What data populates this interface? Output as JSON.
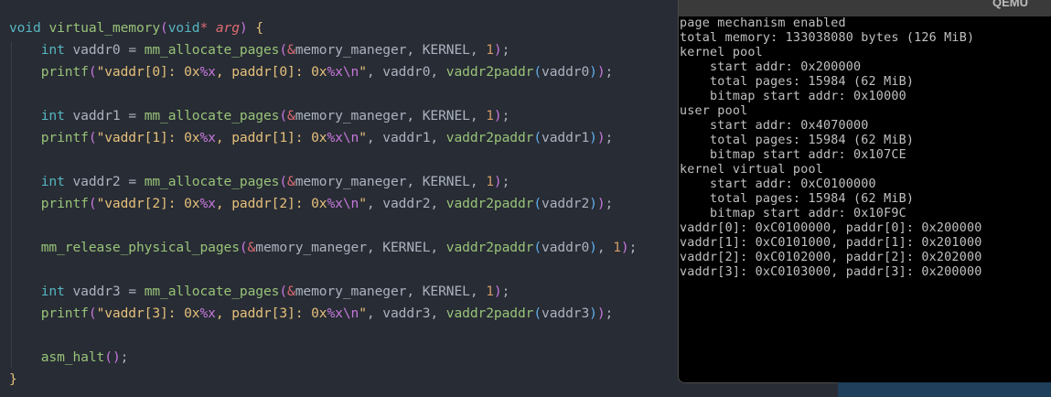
{
  "editor": {
    "lines": [
      "void virtual_memory(void* arg) {",
      "    int vaddr0 = mm_allocate_pages(&memory_maneger, KERNEL, 1);",
      "    printf(\"vaddr[0]: 0x%x, paddr[0]: 0x%x\\n\", vaddr0, vaddr2paddr(vaddr0));",
      "",
      "    int vaddr1 = mm_allocate_pages(&memory_maneger, KERNEL, 1);",
      "    printf(\"vaddr[1]: 0x%x, paddr[1]: 0x%x\\n\", vaddr1, vaddr2paddr(vaddr1));",
      "",
      "    int vaddr2 = mm_allocate_pages(&memory_maneger, KERNEL, 1);",
      "    printf(\"vaddr[2]: 0x%x, paddr[2]: 0x%x\\n\", vaddr2, vaddr2paddr(vaddr2));",
      "",
      "    mm_release_physical_pages(&memory_maneger, KERNEL, vaddr2paddr(vaddr0), 1);",
      "",
      "    int vaddr3 = mm_allocate_pages(&memory_maneger, KERNEL, 1);",
      "    printf(\"vaddr[3]: 0x%x, paddr[3]: 0x%x\\n\", vaddr3, vaddr2paddr(vaddr3));",
      "",
      "    asm_halt();",
      "}"
    ]
  },
  "qemu": {
    "title": "QEMU",
    "output": [
      "page mechanism enabled",
      "total memory: 133038080 bytes (126 MiB)",
      "kernel pool",
      "    start addr: 0x200000",
      "    total pages: 15984 (62 MiB)",
      "    bitmap start addr: 0x10000",
      "user pool",
      "    start addr: 0x4070000",
      "    total pages: 15984 (62 MiB)",
      "    bitmap start addr: 0x107CE",
      "kernel virtual pool",
      "    start addr: 0xC0100000",
      "    total pages: 15984 (62 MiB)",
      "    bitmap start addr: 0x10F9C",
      "vaddr[0]: 0xC0100000, paddr[0]: 0x200000",
      "vaddr[1]: 0xC0101000, paddr[1]: 0x201000",
      "vaddr[2]: 0xC0102000, paddr[2]: 0x202000",
      "vaddr[3]: 0xC0103000, paddr[3]: 0x200000"
    ]
  },
  "colors": {
    "editor_bg": "#282c34",
    "keyword": "#c678dd",
    "type": "#56b6c2",
    "function": "#98c379",
    "string": "#e5c07b",
    "number": "#d19a66",
    "terminal_bg": "#000000",
    "terminal_fg": "#c0c0c0"
  }
}
